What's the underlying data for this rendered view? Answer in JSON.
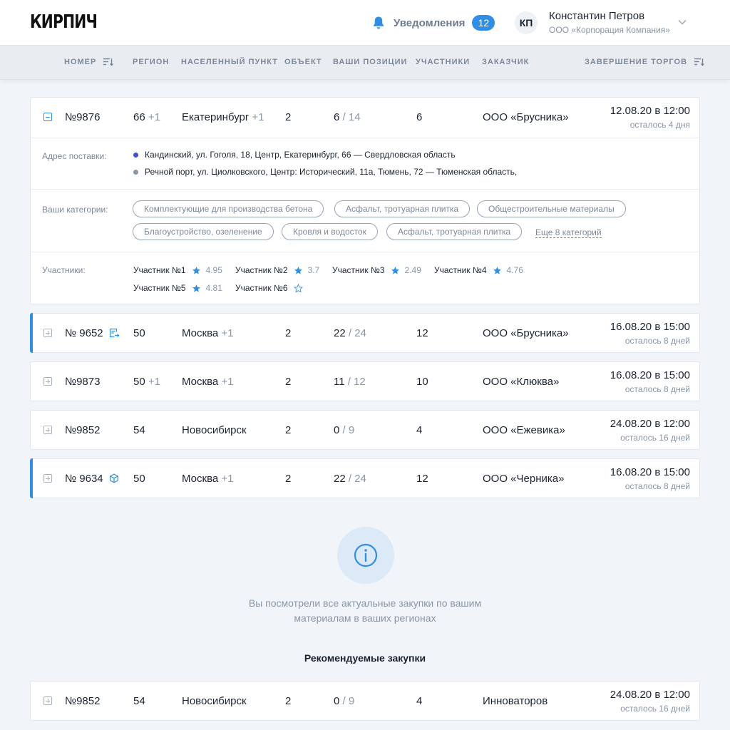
{
  "header": {
    "logo": "КИРПИЧ",
    "notifications_label": "Уведомления",
    "notifications_count": "12",
    "user_initials": "КП",
    "user_name": "Константин Петров",
    "user_company": "ООО «Корпорация Компания»"
  },
  "columns": {
    "number": "НОМЕР",
    "region": "РЕГИОН",
    "locality": "НАСЕЛЕННЫЙ ПУНКТ",
    "object": "ОБЪЕКТ",
    "positions": "ВАШИ ПОЗИЦИИ",
    "participants": "УЧАСТНИКИ",
    "customer": "ЗАКАЗЧИК",
    "deadline": "ЗАВЕРШЕНИЕ ТОРГОВ"
  },
  "orders": [
    {
      "number": "№9876",
      "region": "66",
      "region_extra": "+1",
      "city": "Екатеринбург",
      "city_extra": "+1",
      "objects": "2",
      "pos_have": "6",
      "pos_total": "/ 14",
      "participants": "6",
      "customer": "ООО «Брусника»",
      "date": "12.08.20 в 12:00",
      "remaining": "осталось 4 дня",
      "details": {
        "address_label": "Адрес поставки:",
        "addresses": [
          "Кандинский, ул. Гоголя, 18, Центр, Екатеринбург, 66 — Свердловская область",
          "Речной порт, ул. Циолковского, Центр: Исторический, 11а, Тюмень, 72 — Тюменская область,"
        ],
        "categories_label": "Ваши категории:",
        "categories": [
          "Комплектующие для производства бетона",
          "Асфальт, тротуарная плитка",
          "Общестроительные материалы",
          "Благоустройство, озеленение",
          "Кровля и водосток",
          "Асфальт, тротуарная плитка"
        ],
        "more_categories": "Еще 8 категорий",
        "participants_label": "Участники:",
        "participants": [
          {
            "name": "Участник №1",
            "rating": "4.95"
          },
          {
            "name": "Участник №2",
            "rating": "3.7"
          },
          {
            "name": "Участник №3",
            "rating": "2.49"
          },
          {
            "name": "Участник №4",
            "rating": "4.76"
          },
          {
            "name": "Участник №5",
            "rating": "4.81"
          },
          {
            "name": "Участник №6",
            "rating": ""
          }
        ]
      }
    },
    {
      "number": "№ 9652",
      "region": "50",
      "region_extra": "",
      "city": "Москва",
      "city_extra": "+1",
      "objects": "2",
      "pos_have": "22",
      "pos_total": "/ 24",
      "participants": "12",
      "customer": "ООО «Брусника»",
      "date": "16.08.20 в 15:00",
      "remaining": "осталось 8 дней"
    },
    {
      "number": "№9873",
      "region": "50",
      "region_extra": "+1",
      "city": "Москва",
      "city_extra": "+1",
      "objects": "2",
      "pos_have": "11",
      "pos_total": "/ 12",
      "participants": "10",
      "customer": "ООО «Клюква»",
      "date": "16.08.20 в 15:00",
      "remaining": "осталось 8 дней"
    },
    {
      "number": "№9852",
      "region": "54",
      "region_extra": "",
      "city": "Новосибирск",
      "city_extra": "",
      "objects": "2",
      "pos_have": "0",
      "pos_total": "/ 9",
      "participants": "4",
      "customer": "ООО «Ежевика»",
      "date": "24.08.20 в 12:00",
      "remaining": "осталось 16 дней"
    },
    {
      "number": "№ 9634",
      "region": "50",
      "region_extra": "",
      "city": "Москва",
      "city_extra": "+1",
      "objects": "2",
      "pos_have": "22",
      "pos_total": "/ 24",
      "participants": "12",
      "customer": "ООО «Черника»",
      "date": "16.08.20 в 15:00",
      "remaining": "осталось 8 дней"
    }
  ],
  "info": {
    "message": "Вы посмотрели все актуальные закупки по вашим материалам в ваших регионах",
    "recommended_title": "Рекомендуемые закупки"
  },
  "recommended": [
    {
      "number": "№9852",
      "region": "54",
      "city": "Новосибирск",
      "objects": "2",
      "pos_have": "0",
      "pos_total": "/ 9",
      "participants": "4",
      "customer": "Инноваторов",
      "date": "24.08.20 в 12:00",
      "remaining": "осталось 16 дней"
    }
  ],
  "colors": {
    "accent": "#2e8ee8",
    "address_dot_1": "#3f4fd6",
    "address_dot_2": "#8a96a6"
  }
}
